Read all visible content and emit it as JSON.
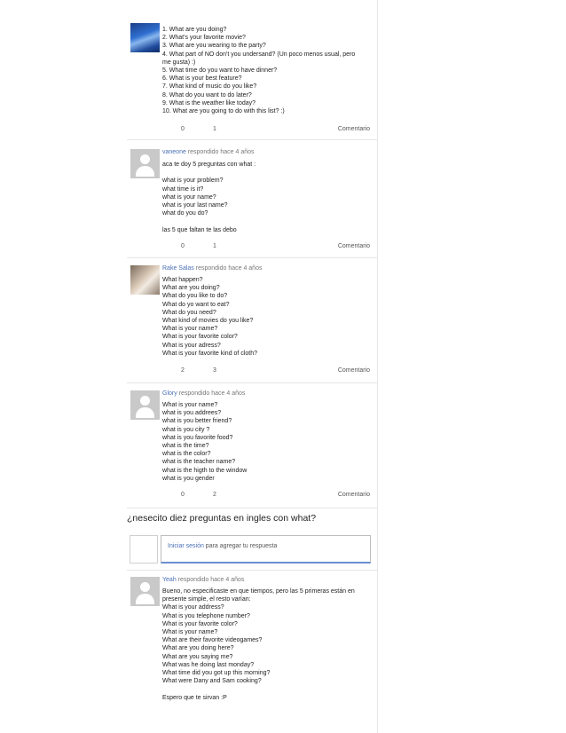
{
  "answers": [
    {
      "user": "",
      "meta": "",
      "avatar": "sea-photo",
      "text": "1. What are you doing?\n2. What's your favorite movie?\n3. What are you wearing to the party?\n4. What part of NO don't you undersand? (Un poco menos usual, pero\nme gusta) :)\n5. What time do you want to have dinner?\n6. What is your best feature?\n7. What kind of music do you like?\n8. What do you want to do later?\n9. What is the weather like today?\n10. What are you going to do with this list? :)",
      "votes_up": "0",
      "votes_down": "1",
      "comment_label": "Comentario"
    },
    {
      "user": "vaneone",
      "meta": " respondido hace 4 años",
      "avatar": "default-avatar",
      "text": "aca te doy 5 preguntas con what :\n\nwhat is your problem?\nwhat time is it?\nwhat is your name?\nwhat is your last name?\nwhat do you do?\n\nlas 5 que faltan te las debo",
      "votes_up": "0",
      "votes_down": "1",
      "comment_label": "Comentario"
    },
    {
      "user": "Rake Salas",
      "meta": " respondido hace 4 años",
      "avatar": "portrait-photo",
      "text": "What happen?\nWhat are you doing?\nWhat do you like to do?\nWhat do yo want to eat?\nWhat do you need?\nWhat kind of movies do you like?\nWhat is your name?\nWhat is your favorite color?\nWhat is your adress?\nWhat is your favorite kind of cloth?",
      "votes_up": "2",
      "votes_down": "3",
      "comment_label": "Comentario"
    },
    {
      "user": "Glory",
      "meta": " respondido hace 4 años",
      "avatar": "default-avatar",
      "text": "What is your name?\nwhat is you addrees?\nwhat is you better friend?\nwhat is you city ?\nwhat is you favorite food?\nwhat is the time?\nwhat is the color?\nwhat is the teacher name?\nwhat is the higth to the window\nwhat is you gender",
      "votes_up": "0",
      "votes_down": "2",
      "comment_label": "Comentario"
    }
  ],
  "question": {
    "title": "¿nesecito diez preguntas en ingles con what?"
  },
  "login_prompt": {
    "link": "Iniciar sesión",
    "rest": " para agregar tu respuesta"
  },
  "last_answer": {
    "user": "Yeah",
    "meta": " respondido hace 4 años",
    "avatar": "default-avatar",
    "text": "Bueno, no especificaste en que tiempos, pero las 5 primeras están en\npresente simple, el resto varían:\nWhat is your address?\nWhat is you telephone number?\nWhat is your favorite color?\nWhat is your name?\nWhat are their favorite videogames?\nWhat are you doing here?\nWhat are you saying me?\nWhat was he doing last monday?\nWhat time did you got up this morning?\nWhat were Dany and Sam cooking?\n\nEspero que te sirvan :P"
  }
}
